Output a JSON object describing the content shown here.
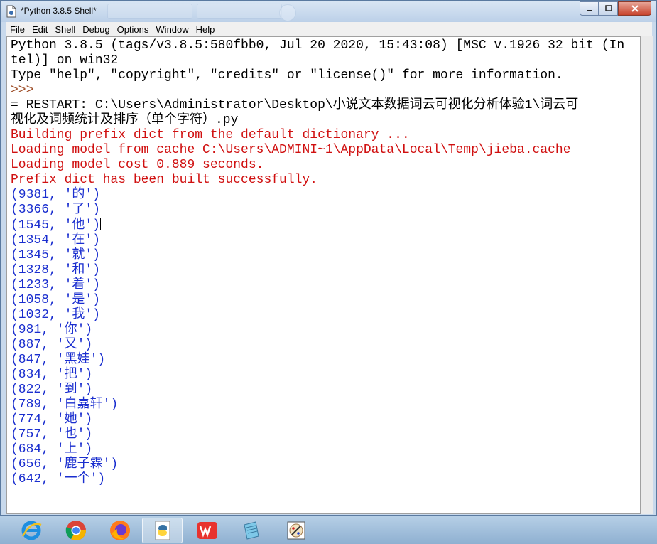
{
  "window": {
    "title": "*Python 3.8.5 Shell*"
  },
  "menu": [
    "File",
    "Edit",
    "Shell",
    "Debug",
    "Options",
    "Window",
    "Help"
  ],
  "console": {
    "header": [
      "Python 3.8.5 (tags/v3.8.5:580fbb0, Jul 20 2020, 15:43:08) [MSC v.1926 32 bit (In",
      "tel)] on win32",
      "Type \"help\", \"copyright\", \"credits\" or \"license()\" for more information."
    ],
    "prompt": ">>>",
    "restart": [
      "= RESTART: C:\\Users\\Administrator\\Desktop\\小说文本数据词云可视化分析体验1\\词云可",
      "视化及词频统计及排序（单个字符）.py"
    ],
    "messages": [
      "Building prefix dict from the default dictionary ...",
      "Loading model from cache C:\\Users\\ADMINI~1\\AppData\\Local\\Temp\\jieba.cache",
      "Loading model cost 0.889 seconds.",
      "Prefix dict has been built successfully."
    ],
    "results": [
      "(9381, '的')",
      "(3366, '了')",
      "(1545, '他')",
      "(1354, '在')",
      "(1345, '就')",
      "(1328, '和')",
      "(1233, '着')",
      "(1058, '是')",
      "(1032, '我')",
      "(981, '你')",
      "(887, '又')",
      "(847, '黑娃')",
      "(834, '把')",
      "(822, '到')",
      "(789, '白嘉轩')",
      "(774, '她')",
      "(757, '也')",
      "(684, '上')",
      "(656, '鹿子霖')",
      "(642, '一个')"
    ]
  },
  "colors": {
    "output_red": "#d01010",
    "output_blue": "#1a2ecf",
    "prompt": "#a0522d"
  },
  "taskbar": [
    "ie-icon",
    "chrome-icon",
    "firefox-icon",
    "python-icon",
    "wps-icon",
    "notepad-icon",
    "paint-icon"
  ]
}
